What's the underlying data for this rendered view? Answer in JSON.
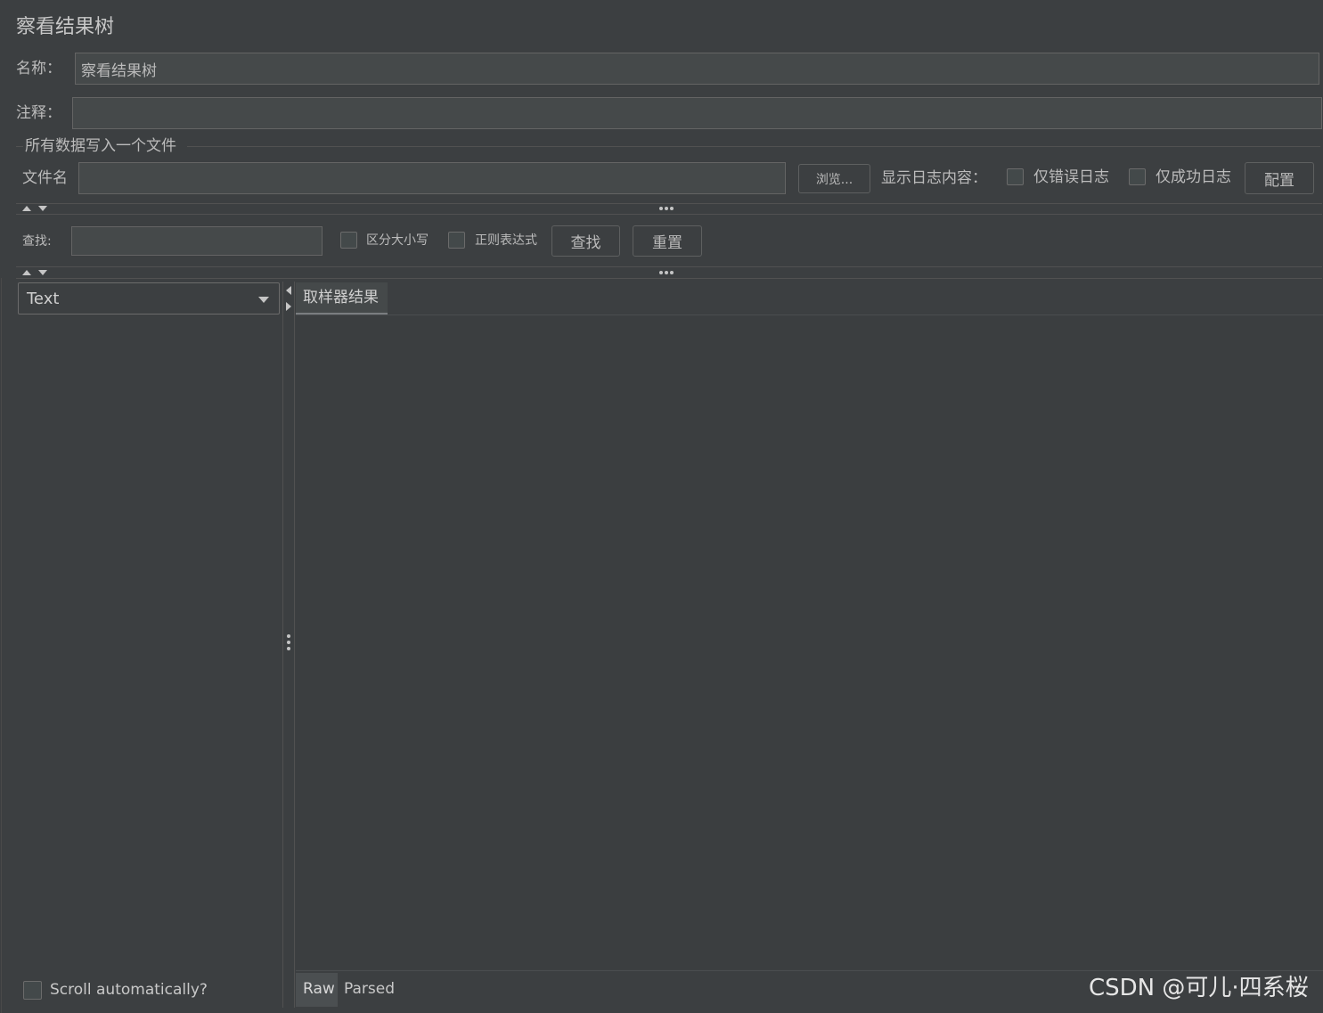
{
  "panel": {
    "title": "察看结果树"
  },
  "name_field": {
    "label": "名称：",
    "value": "察看结果树"
  },
  "comment_field": {
    "label": "注释：",
    "value": ""
  },
  "file_section": {
    "legend": "所有数据写入一个文件",
    "filename_label": "文件名",
    "filename_value": "",
    "browse_label": "浏览...",
    "log_display_label": "显示日志内容：",
    "errors_only_label": "仅错误日志",
    "success_only_label": "仅成功日志",
    "configure_label": "配置"
  },
  "search": {
    "label": "查找:",
    "value": "",
    "case_sensitive_label": "区分大小写",
    "regex_label": "正则表达式",
    "find_label": "查找",
    "reset_label": "重置"
  },
  "renderer": {
    "selected": "Text"
  },
  "results": {
    "tab_label": "取样器结果",
    "bottom_tabs": [
      "Raw",
      "Parsed"
    ]
  },
  "scroll_auto_label": "Scroll automatically?",
  "watermark": "CSDN @可儿·四系桜",
  "colors": {
    "background": "#3c3f41",
    "field_bg": "#45494a",
    "text": "#bbbbbb",
    "tab_underline": "#7a7d80"
  }
}
